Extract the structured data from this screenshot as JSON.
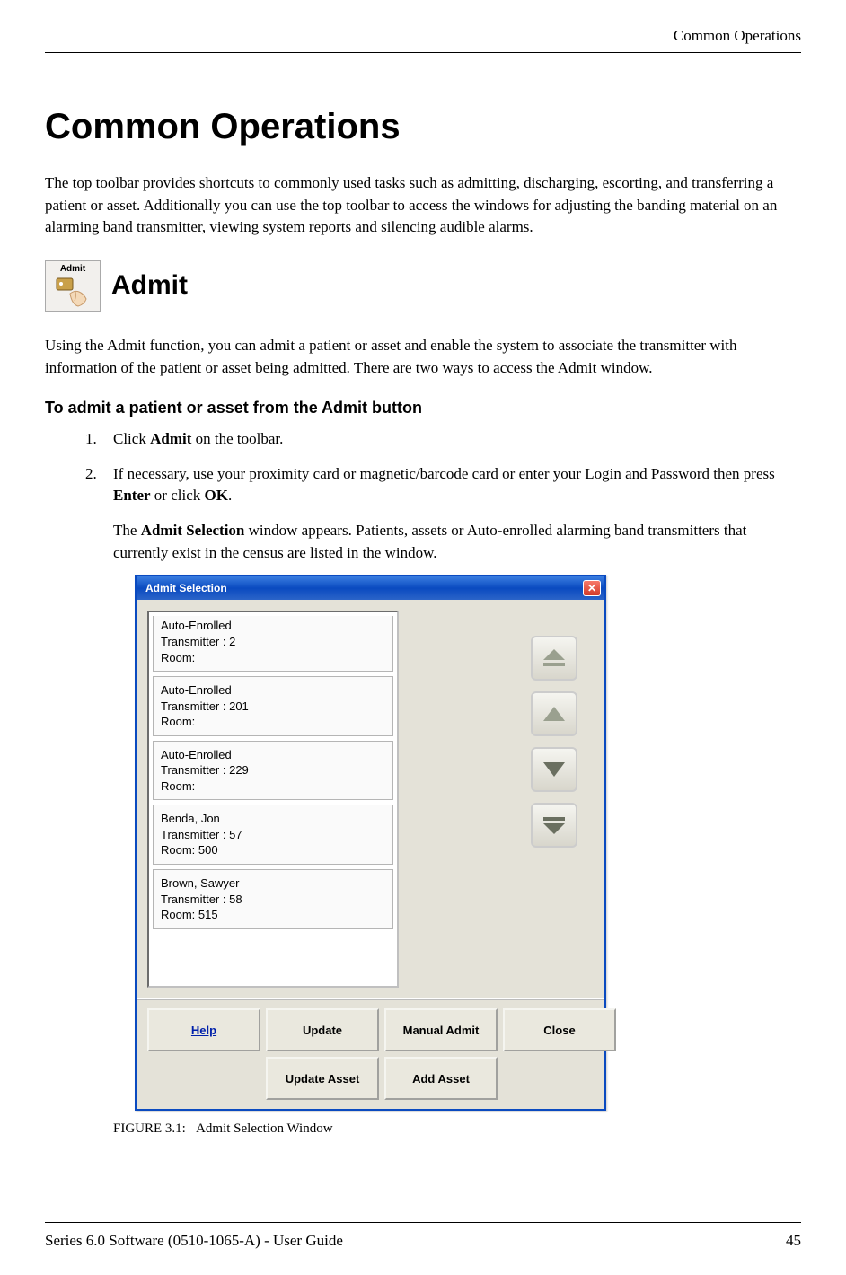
{
  "header": {
    "running_title": "Common Operations"
  },
  "title": "Common Operations",
  "intro": "The top toolbar provides shortcuts to commonly used tasks such as admitting, discharging, escorting, and transferring a patient or asset. Additionally you can use the top toolbar to access the windows for adjusting the banding material on an alarming band transmitter, viewing system reports and silencing audible alarms.",
  "admit": {
    "icon_label": "Admit",
    "heading": "Admit",
    "desc": "Using the Admit function, you can admit a patient or asset and enable the system to associate the transmitter with information of the patient or asset being admitted. There are two ways to access the Admit window."
  },
  "procedure": {
    "heading": "To admit a patient or asset from the Admit button",
    "step1_pre": "Click ",
    "step1_bold": "Admit",
    "step1_post": " on the toolbar.",
    "step2_pre": "If necessary, use your proximity card or magnetic/barcode card or enter your Login and Password then press ",
    "step2_bold1": "Enter",
    "step2_mid": " or click ",
    "step2_bold2": "OK",
    "step2_post": ".",
    "note_pre": "The ",
    "note_bold": "Admit Selection",
    "note_post": " window appears. Patients, assets or Auto-enrolled alarming band transmitters that currently exist in the census are listed in the window."
  },
  "dialog": {
    "title": "Admit Selection",
    "close_x": "✕",
    "items": [
      {
        "line1": "Auto-Enrolled",
        "line2": "Transmitter : 2",
        "line3": "Room:"
      },
      {
        "line1": "Auto-Enrolled",
        "line2": "Transmitter : 201",
        "line3": "Room:"
      },
      {
        "line1": "Auto-Enrolled",
        "line2": "Transmitter : 229",
        "line3": "Room:"
      },
      {
        "line1": "Benda, Jon",
        "line2": "Transmitter : 57",
        "line3": "Room: 500"
      },
      {
        "line1": "Brown, Sawyer",
        "line2": "Transmitter : 58",
        "line3": "Room: 515"
      }
    ],
    "buttons": {
      "help": "Help",
      "update": "Update",
      "manual_admit": "Manual Admit",
      "close": "Close",
      "update_asset": "Update Asset",
      "add_asset": "Add Asset"
    }
  },
  "figure": {
    "label": "FIGURE 3.1:",
    "caption": "Admit Selection Window"
  },
  "footer": {
    "left": "Series 6.0 Software (0510-1065-A) - User Guide",
    "page": "45"
  }
}
